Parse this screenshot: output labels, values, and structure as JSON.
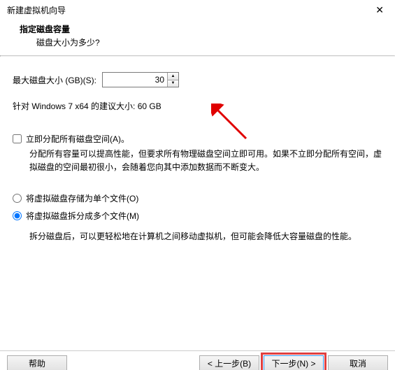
{
  "window": {
    "title": "新建虚拟机向导"
  },
  "header": {
    "title": "指定磁盘容量",
    "subtitle": "磁盘大小为多少?"
  },
  "size": {
    "label": "最大磁盘大小 (GB)(S):",
    "value": "30",
    "recommend": "针对 Windows 7 x64 的建议大小: 60 GB"
  },
  "allocate": {
    "label": "立即分配所有磁盘空间(A)。",
    "desc": "分配所有容量可以提高性能，但要求所有物理磁盘空间立即可用。如果不立即分配所有空间，虚拟磁盘的空间最初很小，会随着您向其中添加数据而不断变大。"
  },
  "storage": {
    "single": "将虚拟磁盘存储为单个文件(O)",
    "split": "将虚拟磁盘拆分成多个文件(M)",
    "split_desc": "拆分磁盘后，可以更轻松地在计算机之间移动虚拟机，但可能会降低大容量磁盘的性能。"
  },
  "footer": {
    "help": "帮助",
    "back": "< 上一步(B)",
    "next": "下一步(N) >",
    "cancel": "取消"
  }
}
